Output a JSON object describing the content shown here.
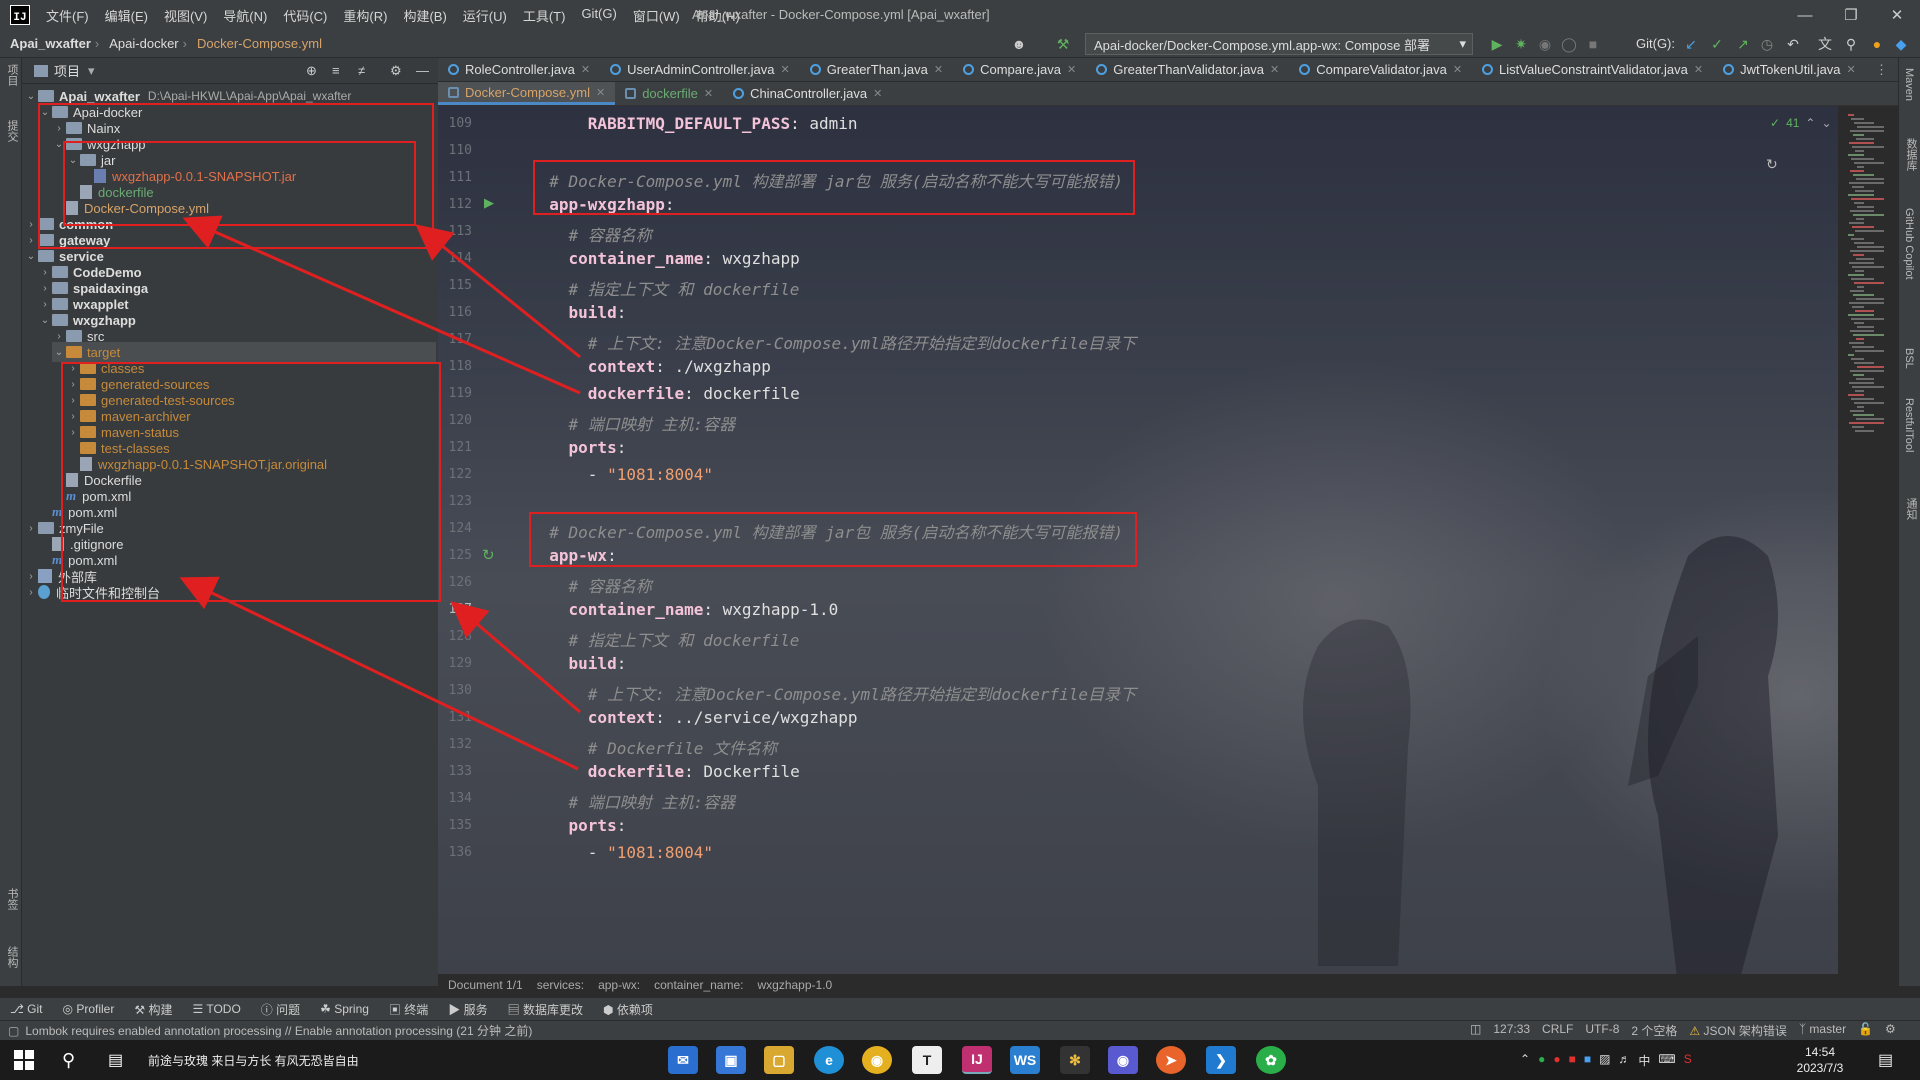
{
  "titlebar": {
    "menu": [
      "文件(F)",
      "编辑(E)",
      "视图(V)",
      "导航(N)",
      "代码(C)",
      "重构(R)",
      "构建(B)",
      "运行(U)",
      "工具(T)",
      "Git(G)",
      "窗口(W)",
      "帮助(H)"
    ],
    "title": "Apai_wxafter - Docker-Compose.yml [Apai_wxafter]"
  },
  "navbar": {
    "crumbs": [
      "Apai_wxafter",
      "Apai-docker",
      "Docker-Compose.yml"
    ],
    "run_config": "Apai-docker/Docker-Compose.yml.app-wx: Compose 部署",
    "git_label": "Git(G):"
  },
  "left_stripe": {
    "top": "项目",
    "mid": "提交",
    "bottom1": "书签",
    "bottom2": "结构"
  },
  "right_stripe": [
    "Maven",
    "数据库",
    "GitHub Copilot",
    "BSL",
    "RestfulTool",
    "通知"
  ],
  "project": {
    "header": "项目",
    "root_name": "Apai_wxafter",
    "root_path": "D:\\Apai-HKWL\\Apai-App\\Apai_wxafter",
    "rows": [
      "Apai-docker",
      "Nainx",
      "wxgzhapp",
      "jar",
      "wxgzhapp-0.0.1-SNAPSHOT.jar",
      "dockerfile",
      "Docker-Compose.yml",
      "common",
      "gateway",
      "service",
      "CodeDemo",
      "spaidaxinga",
      "wxapplet",
      "wxgzhapp",
      "src",
      "target",
      "classes",
      "generated-sources",
      "generated-test-sources",
      "maven-archiver",
      "maven-status",
      "test-classes",
      "wxgzhapp-0.0.1-SNAPSHOT.jar.original",
      "Dockerfile",
      "pom.xml",
      "pom.xml",
      "zmyFile",
      ".gitignore",
      "pom.xml",
      "外部库",
      "临时文件和控制台"
    ]
  },
  "tabs": {
    "row1": [
      "RoleController.java",
      "UserAdminController.java",
      "GreaterThan.java",
      "Compare.java",
      "GreaterThanValidator.java",
      "CompareValidator.java",
      "ListValueConstraintValidator.java",
      "JwtTokenUtil.java"
    ],
    "row2": [
      "Docker-Compose.yml",
      "dockerfile",
      "ChinaController.java"
    ]
  },
  "editor": {
    "inspections": "41",
    "lines": [
      {
        "n": "109",
        "t": "      RABBITMQ_DEFAULT_PASS: admin"
      },
      {
        "n": "110",
        "t": ""
      },
      {
        "n": "111",
        "t": "  # Docker-Compose.yml 构建部署 jar包 服务(启动名称不能大写可能报错)"
      },
      {
        "n": "112",
        "t": "  app-wxgzhapp:"
      },
      {
        "n": "113",
        "t": "    # 容器名称"
      },
      {
        "n": "114",
        "t": "    container_name: wxgzhapp"
      },
      {
        "n": "115",
        "t": "    # 指定上下文 和 dockerfile"
      },
      {
        "n": "116",
        "t": "    build:"
      },
      {
        "n": "117",
        "t": "      # 上下文: 注意Docker-Compose.yml路径开始指定到dockerfile目录下"
      },
      {
        "n": "118",
        "t": "      context: ./wxgzhapp"
      },
      {
        "n": "119",
        "t": "      dockerfile: dockerfile"
      },
      {
        "n": "120",
        "t": "    # 端口映射 主机:容器"
      },
      {
        "n": "121",
        "t": "    ports:"
      },
      {
        "n": "122",
        "t": "      - \"1081:8004\""
      },
      {
        "n": "123",
        "t": ""
      },
      {
        "n": "124",
        "t": "  # Docker-Compose.yml 构建部署 jar包 服务(启动名称不能大写可能报错)"
      },
      {
        "n": "125",
        "t": "  app-wx:"
      },
      {
        "n": "126",
        "t": "    # 容器名称"
      },
      {
        "n": "127",
        "t": "    container_name: wxgzhapp-1.0"
      },
      {
        "n": "128",
        "t": "    # 指定上下文 和 dockerfile"
      },
      {
        "n": "129",
        "t": "    build:"
      },
      {
        "n": "130",
        "t": "      # 上下文: 注意Docker-Compose.yml路径开始指定到dockerfile目录下"
      },
      {
        "n": "131",
        "t": "      context: ../service/wxgzhapp"
      },
      {
        "n": "132",
        "t": "      # Dockerfile 文件名称"
      },
      {
        "n": "133",
        "t": "      dockerfile: Dockerfile"
      },
      {
        "n": "134",
        "t": "    # 端口映射 主机:容器"
      },
      {
        "n": "135",
        "t": "    ports:"
      },
      {
        "n": "136",
        "t": "      - \"1081:8004\""
      }
    ]
  },
  "breadcrumb_bar": [
    "Document 1/1",
    "services:",
    "app-wx:",
    "container_name:",
    "wxgzhapp-1.0"
  ],
  "toolwindows": [
    "Git",
    "Profiler",
    "构建",
    "TODO",
    "问题",
    "Spring",
    "终端",
    "服务",
    "数据库更改",
    "依赖项"
  ],
  "status": {
    "message": "Lombok requires enabled annotation processing // Enable annotation processing (21 分钟 之前)",
    "position": "127:33",
    "line_sep": "CRLF",
    "encoding": "UTF-8",
    "indent": "2 个空格",
    "schema": "JSON 架构错误",
    "branch": "master"
  },
  "taskbar": {
    "song": "前途与玫瑰 来日与方长 有风无恐皆自由",
    "time": "14:54",
    "date": "2023/7/3",
    "ime": "中"
  },
  "colors": {
    "annotation_red": "#e02020",
    "accent": "#4a88c7"
  }
}
